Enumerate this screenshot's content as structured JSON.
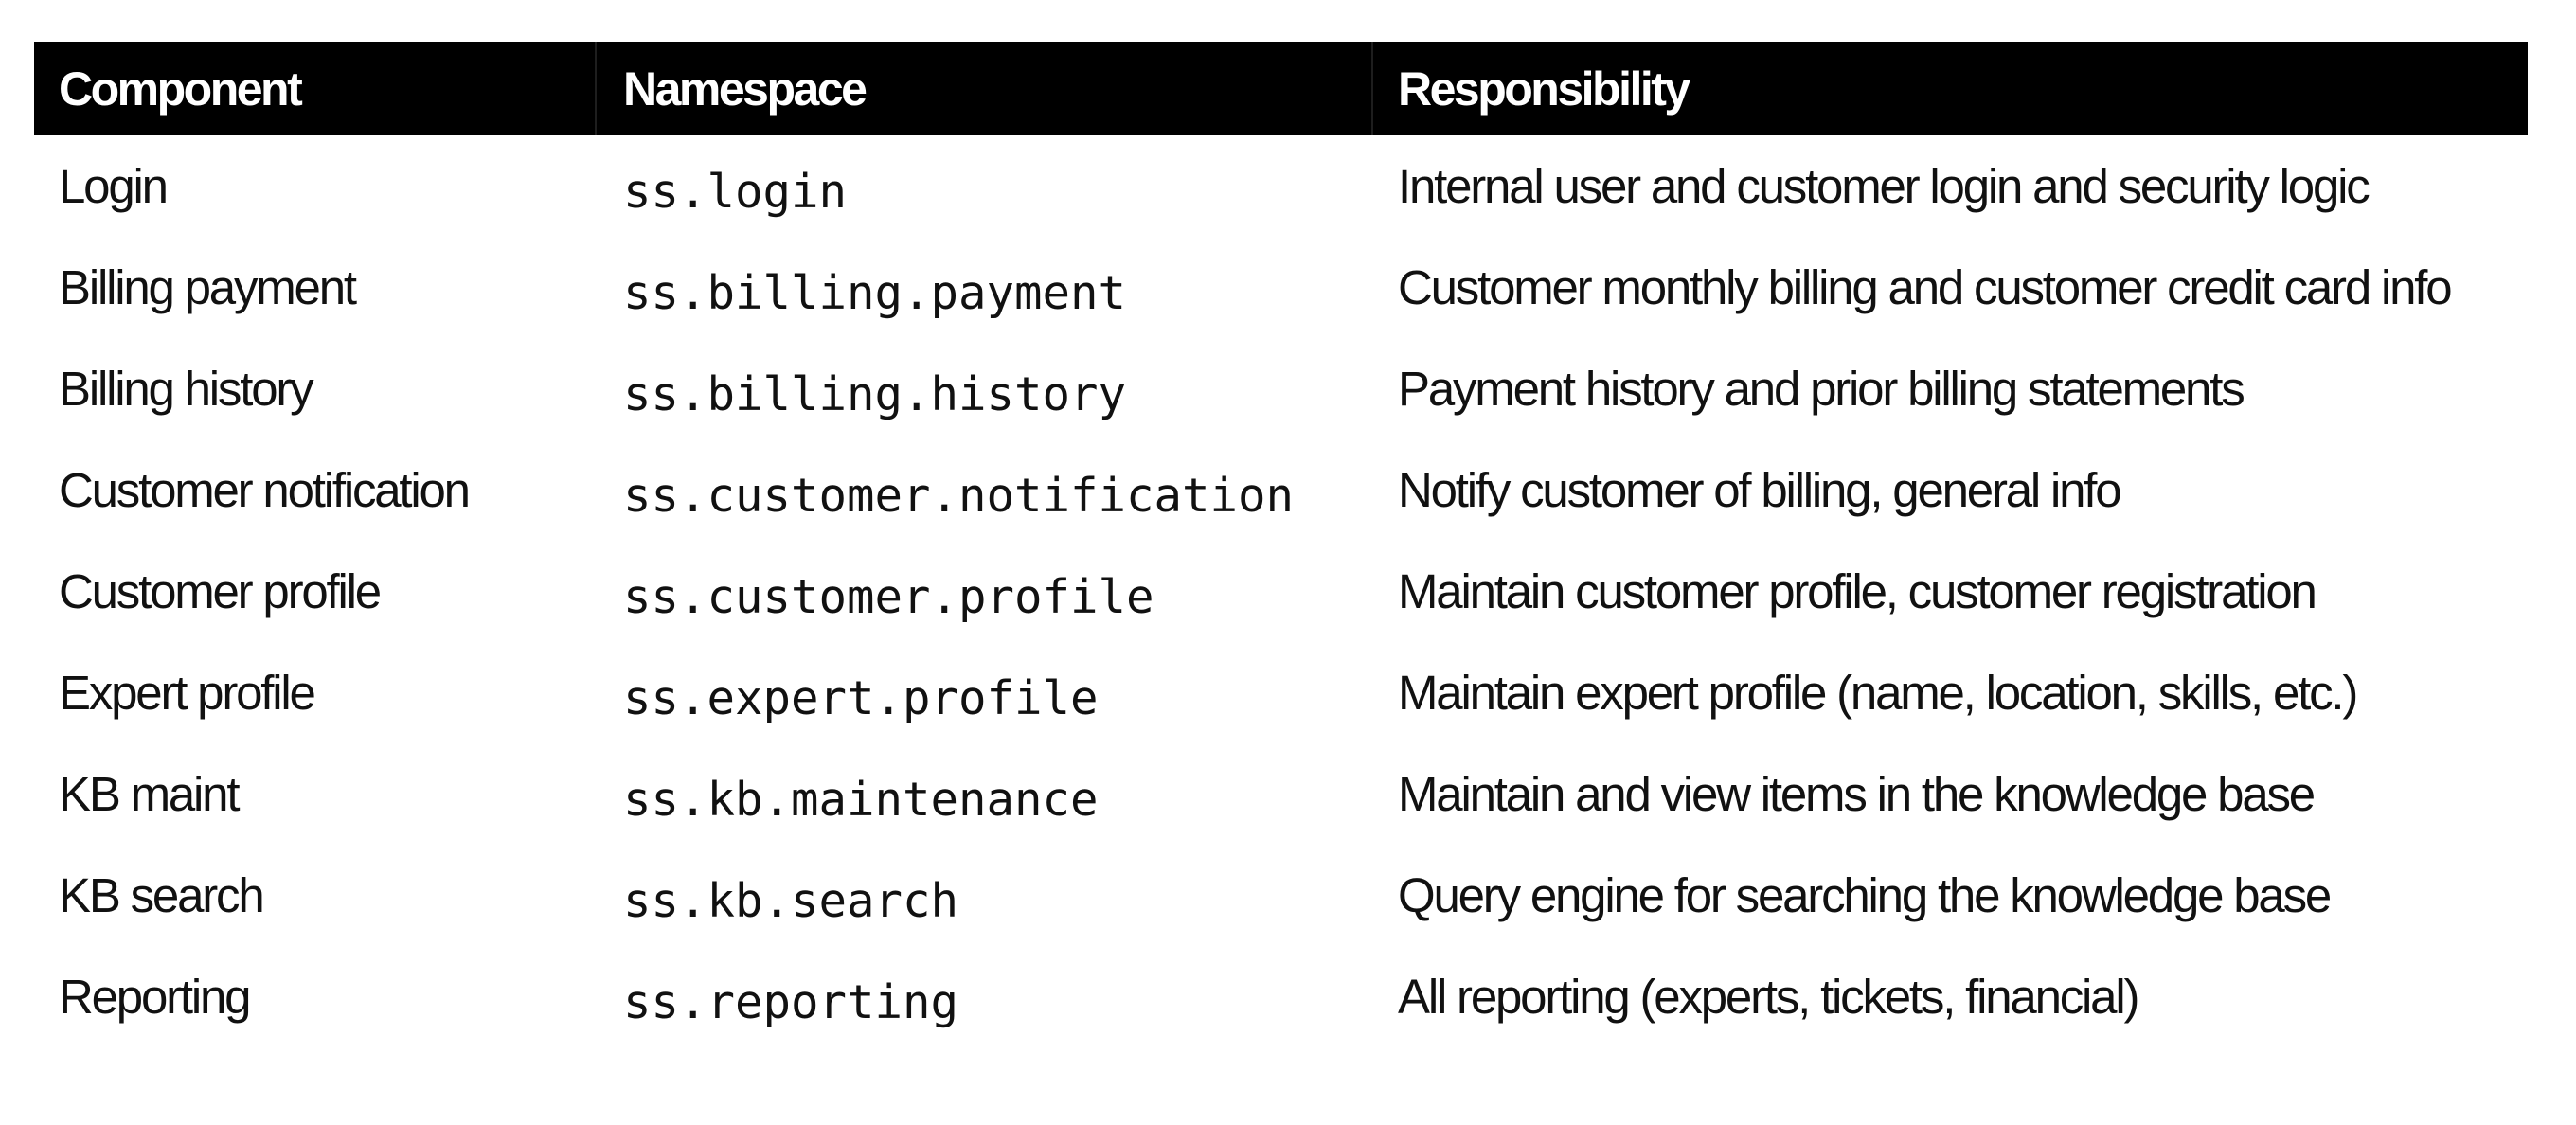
{
  "headers": {
    "component": "Component",
    "namespace": "Namespace",
    "responsibility": "Responsibility"
  },
  "rows": [
    {
      "component": "Login",
      "namespace": "ss.login",
      "responsibility": "Internal user and customer login and security logic"
    },
    {
      "component": "Billing payment",
      "namespace": "ss.billing.payment",
      "responsibility": "Customer monthly billing and customer credit card info"
    },
    {
      "component": "Billing history",
      "namespace": "ss.billing.history",
      "responsibility": "Payment history and prior billing statements"
    },
    {
      "component": "Customer notification",
      "namespace": "ss.customer.notification",
      "responsibility": "Notify customer of billing, general info"
    },
    {
      "component": "Customer profile",
      "namespace": "ss.customer.profile",
      "responsibility": "Maintain customer profile, customer registration"
    },
    {
      "component": "Expert profile",
      "namespace": "ss.expert.profile",
      "responsibility": "Maintain expert profile (name, location, skills, etc.)"
    },
    {
      "component": "KB maint",
      "namespace": "ss.kb.maintenance",
      "responsibility": "Maintain and view items in the knowledge base"
    },
    {
      "component": "KB search",
      "namespace": "ss.kb.search",
      "responsibility": "Query engine for searching the knowledge base"
    },
    {
      "component": "Reporting",
      "namespace": "ss.reporting",
      "responsibility": "All reporting (experts, tickets, financial)"
    }
  ]
}
